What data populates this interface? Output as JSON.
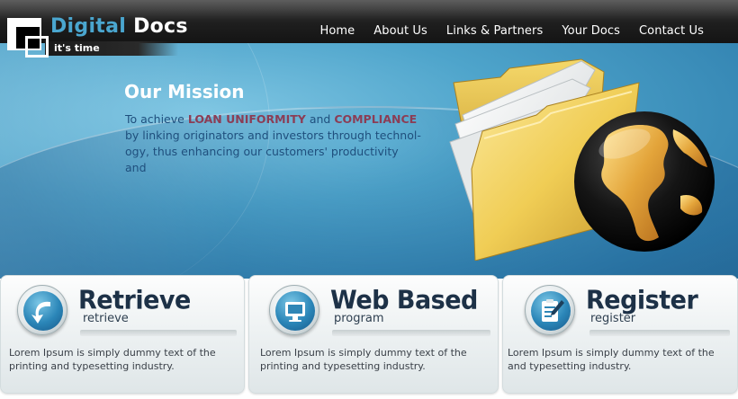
{
  "brand": {
    "name_part1": "Digital",
    "name_part2": "Docs",
    "tagline": "it's time"
  },
  "nav": {
    "items": [
      {
        "label": "Home"
      },
      {
        "label": "About Us"
      },
      {
        "label": "Links & Partners"
      },
      {
        "label": "Your Docs"
      },
      {
        "label": "Contact Us"
      }
    ]
  },
  "hero": {
    "title": "Our Mission",
    "text_lead": "To achieve ",
    "highlight1": "LOAN UNIFORMITY",
    "text_mid": " and ",
    "highlight2": "COMPLIANCE",
    "text_rest": "by linking originators and investors through technol-ogy, thus enhancing our customers' productivity and"
  },
  "cards": [
    {
      "title": "Retrieve",
      "subtitle": "retrieve",
      "icon": "curved-arrow-icon",
      "body": "Lorem Ipsum is simply dummy text of the printing and typesetting industry."
    },
    {
      "title": "Web Based",
      "subtitle": "program",
      "icon": "monitor-icon",
      "body": "Lorem Ipsum is simply dummy text of the printing and typesetting industry."
    },
    {
      "title": "Register",
      "subtitle": "register",
      "icon": "clipboard-pen-icon",
      "body": "Lorem Ipsum is simply dummy text of the and typesetting industry."
    }
  ],
  "colors": {
    "brand_blue": "#4aa6cf",
    "highlight": "#8b3d55",
    "mission_text": "#1f4f7d",
    "card_title": "#1d3147"
  }
}
